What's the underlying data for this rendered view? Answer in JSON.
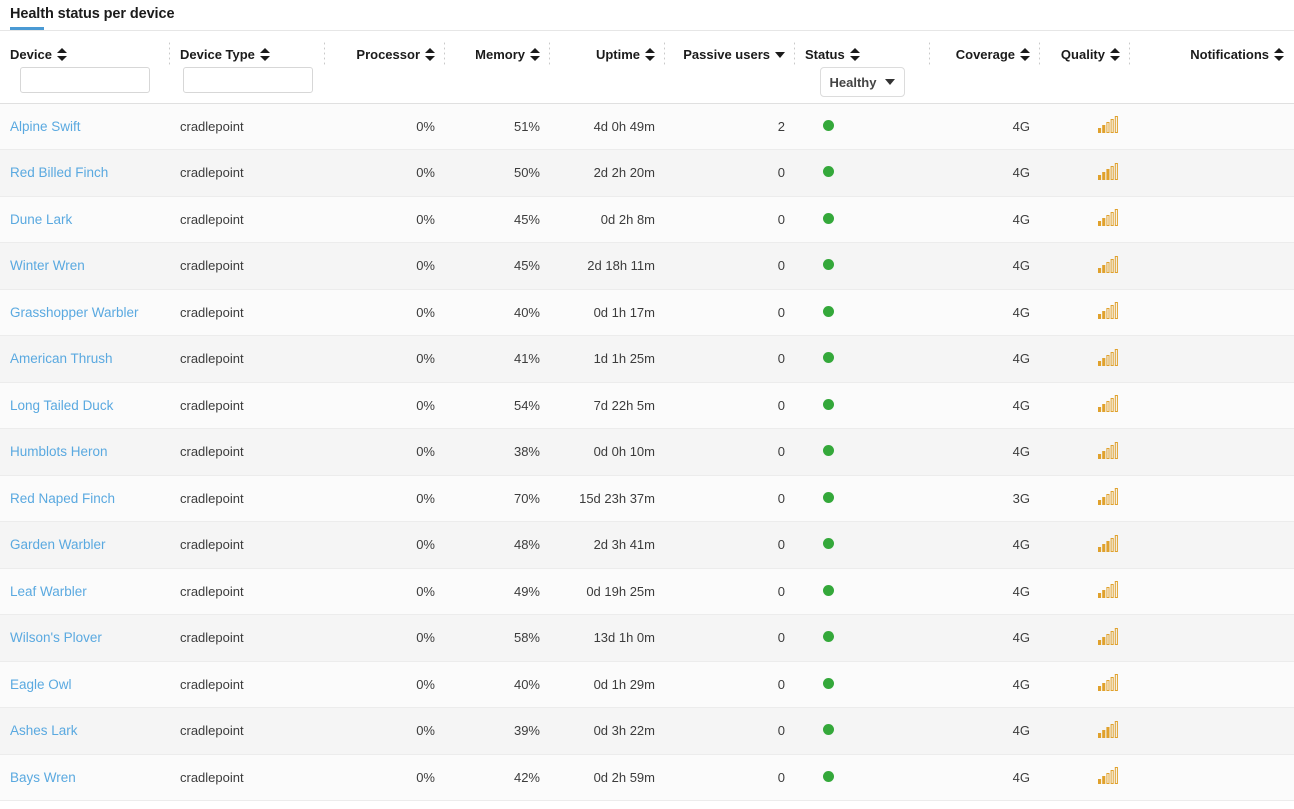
{
  "panel": {
    "title": "Health status per device",
    "accent_color": "#4a9ad4"
  },
  "colors": {
    "link": "#5aa9e0",
    "status_healthy": "#34a83a",
    "coverage_4g": "#54b05c",
    "coverage_3g": "#e0a12c",
    "signal_bar": "#e0a12c"
  },
  "columns": [
    {
      "key": "device",
      "label": "Device",
      "align": "left",
      "sort": "both",
      "filter": "text",
      "filter_value": "",
      "filter_placeholder": ""
    },
    {
      "key": "device_type",
      "label": "Device Type",
      "align": "left",
      "sort": "both",
      "filter": "text",
      "filter_value": "",
      "filter_placeholder": ""
    },
    {
      "key": "processor",
      "label": "Processor",
      "align": "right",
      "sort": "both",
      "filter": "none"
    },
    {
      "key": "memory",
      "label": "Memory",
      "align": "right",
      "sort": "both",
      "filter": "none"
    },
    {
      "key": "uptime",
      "label": "Uptime",
      "align": "right",
      "sort": "both",
      "filter": "none"
    },
    {
      "key": "passive_users",
      "label": "Passive users",
      "align": "right",
      "sort": "desc",
      "filter": "none"
    },
    {
      "key": "status",
      "label": "Status",
      "align": "left",
      "sort": "both",
      "filter": "select",
      "filter_value": "Healthy"
    },
    {
      "key": "coverage",
      "label": "Coverage",
      "align": "right",
      "sort": "both",
      "filter": "none"
    },
    {
      "key": "quality",
      "label": "Quality",
      "align": "right",
      "sort": "both",
      "filter": "none"
    },
    {
      "key": "notifications",
      "label": "Notifications",
      "align": "right",
      "sort": "both",
      "filter": "none"
    }
  ],
  "rows": [
    {
      "device": "Alpine Swift",
      "device_type": "cradlepoint",
      "processor": "0%",
      "memory": "51%",
      "uptime": "4d 0h 49m",
      "passive_users": "2",
      "status": "healthy",
      "coverage": "4G",
      "quality_bars": 2,
      "notifications": ""
    },
    {
      "device": "Red Billed Finch",
      "device_type": "cradlepoint",
      "processor": "0%",
      "memory": "50%",
      "uptime": "2d 2h 20m",
      "passive_users": "0",
      "status": "healthy",
      "coverage": "4G",
      "quality_bars": 3,
      "notifications": ""
    },
    {
      "device": "Dune Lark",
      "device_type": "cradlepoint",
      "processor": "0%",
      "memory": "45%",
      "uptime": "0d 2h 8m",
      "passive_users": "0",
      "status": "healthy",
      "coverage": "4G",
      "quality_bars": 2,
      "notifications": ""
    },
    {
      "device": "Winter Wren",
      "device_type": "cradlepoint",
      "processor": "0%",
      "memory": "45%",
      "uptime": "2d 18h 11m",
      "passive_users": "0",
      "status": "healthy",
      "coverage": "4G",
      "quality_bars": 2,
      "notifications": ""
    },
    {
      "device": "Grasshopper Warbler",
      "device_type": "cradlepoint",
      "processor": "0%",
      "memory": "40%",
      "uptime": "0d 1h 17m",
      "passive_users": "0",
      "status": "healthy",
      "coverage": "4G",
      "quality_bars": 2,
      "notifications": ""
    },
    {
      "device": "American Thrush",
      "device_type": "cradlepoint",
      "processor": "0%",
      "memory": "41%",
      "uptime": "1d 1h 25m",
      "passive_users": "0",
      "status": "healthy",
      "coverage": "4G",
      "quality_bars": 2,
      "notifications": ""
    },
    {
      "device": "Long Tailed Duck",
      "device_type": "cradlepoint",
      "processor": "0%",
      "memory": "54%",
      "uptime": "7d 22h 5m",
      "passive_users": "0",
      "status": "healthy",
      "coverage": "4G",
      "quality_bars": 2,
      "notifications": ""
    },
    {
      "device": "Humblots Heron",
      "device_type": "cradlepoint",
      "processor": "0%",
      "memory": "38%",
      "uptime": "0d 0h 10m",
      "passive_users": "0",
      "status": "healthy",
      "coverage": "4G",
      "quality_bars": 2,
      "notifications": ""
    },
    {
      "device": "Red Naped Finch",
      "device_type": "cradlepoint",
      "processor": "0%",
      "memory": "70%",
      "uptime": "15d 23h 37m",
      "passive_users": "0",
      "status": "healthy",
      "coverage": "3G",
      "quality_bars": 2,
      "notifications": ""
    },
    {
      "device": "Garden Warbler",
      "device_type": "cradlepoint",
      "processor": "0%",
      "memory": "48%",
      "uptime": "2d 3h 41m",
      "passive_users": "0",
      "status": "healthy",
      "coverage": "4G",
      "quality_bars": 3,
      "notifications": ""
    },
    {
      "device": "Leaf Warbler",
      "device_type": "cradlepoint",
      "processor": "0%",
      "memory": "49%",
      "uptime": "0d 19h 25m",
      "passive_users": "0",
      "status": "healthy",
      "coverage": "4G",
      "quality_bars": 2,
      "notifications": ""
    },
    {
      "device": "Wilson's Plover",
      "device_type": "cradlepoint",
      "processor": "0%",
      "memory": "58%",
      "uptime": "13d 1h 0m",
      "passive_users": "0",
      "status": "healthy",
      "coverage": "4G",
      "quality_bars": 2,
      "notifications": ""
    },
    {
      "device": "Eagle Owl",
      "device_type": "cradlepoint",
      "processor": "0%",
      "memory": "40%",
      "uptime": "0d 1h 29m",
      "passive_users": "0",
      "status": "healthy",
      "coverage": "4G",
      "quality_bars": 2,
      "notifications": ""
    },
    {
      "device": "Ashes Lark",
      "device_type": "cradlepoint",
      "processor": "0%",
      "memory": "39%",
      "uptime": "0d 3h 22m",
      "passive_users": "0",
      "status": "healthy",
      "coverage": "4G",
      "quality_bars": 3,
      "notifications": ""
    },
    {
      "device": "Bays Wren",
      "device_type": "cradlepoint",
      "processor": "0%",
      "memory": "42%",
      "uptime": "0d 2h 59m",
      "passive_users": "0",
      "status": "healthy",
      "coverage": "4G",
      "quality_bars": 2,
      "notifications": ""
    }
  ]
}
